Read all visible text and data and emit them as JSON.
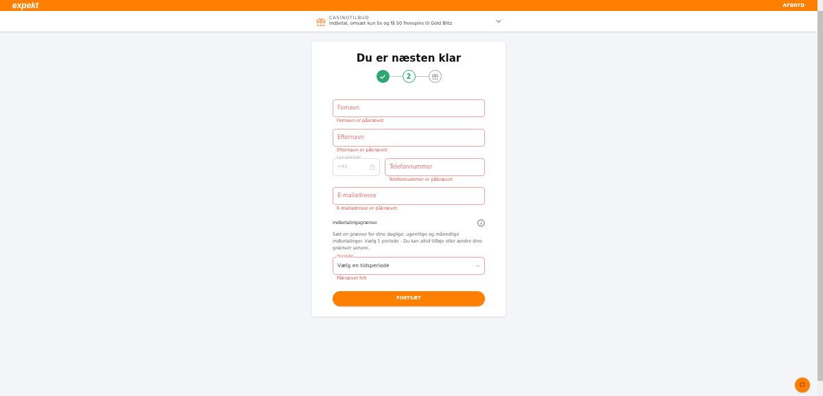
{
  "header": {
    "logo": "expekt",
    "cancel": "AFBRYD"
  },
  "offer": {
    "label": "CASINOTILBUD",
    "text": "Indbetal, omsæt kun 5x og få 50 freespins til Gold Blitz"
  },
  "card": {
    "title": "Du er næsten klar",
    "steps": [
      {
        "kind": "done"
      },
      {
        "kind": "current",
        "label": "2"
      },
      {
        "kind": "gift"
      }
    ],
    "fields": [
      {
        "kind": "text",
        "placeholder": "Fornavn",
        "error": "Fornavn er påkrævet"
      },
      {
        "kind": "text",
        "placeholder": "Efternavn",
        "error": "Efternavn er påkrævet"
      },
      {
        "kind": "phone",
        "code_label": "Landekode",
        "code_value": "+45",
        "placeholder": "Telefonnummer",
        "error": "Telefonnummer er påkrævet"
      },
      {
        "kind": "text",
        "placeholder": "E-mailadresse",
        "error": "E-mailadresse er påkrævet"
      }
    ],
    "limit": {
      "title": "Indbetalingsgrænse",
      "description": "Sæt en grænse for dine daglige, ugentlige og månedlige indbetalinger. Vælg 1 periode - Du kan altid tilføje eller ændre dine grænser senere.",
      "select_label": "Periode",
      "select_value": "Vælg en tidsperiode",
      "error": "Påkrævet felt"
    },
    "submit": "FORTSÆT"
  }
}
